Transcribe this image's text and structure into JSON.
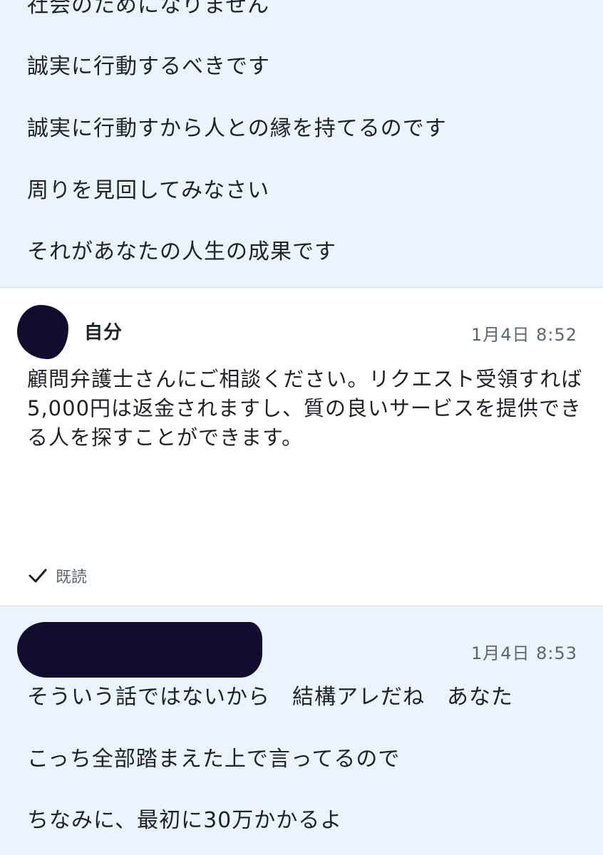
{
  "top_message": {
    "lines": [
      "社会のためになりません",
      "誠実に行動するべきです",
      "誠実に行動すから人との縁を持てるのです",
      "周りを見回してみなさい",
      "それがあなたの人生の成果です"
    ]
  },
  "my_message": {
    "sender": "自分",
    "time": "1月4日 8:52",
    "text": "顧問弁護士さんにご相談ください。リクエスト受領すれば5,000円は返金されますし、質の良いサービスを提供できる人を探すことができます。",
    "read_label": "既読"
  },
  "other_message": {
    "time": "1月4日 8:53",
    "lines": [
      "そういう話ではないから　結構アレだね　あなた",
      "こっち全部踏まえた上で言ってるので",
      "ちなみに、最初に30万かかるよ"
    ]
  },
  "colors": {
    "received_bg": "#eaf3fe",
    "sent_bg": "#ffffff",
    "redaction": "#120d2e",
    "muted_text": "#5b6673"
  }
}
